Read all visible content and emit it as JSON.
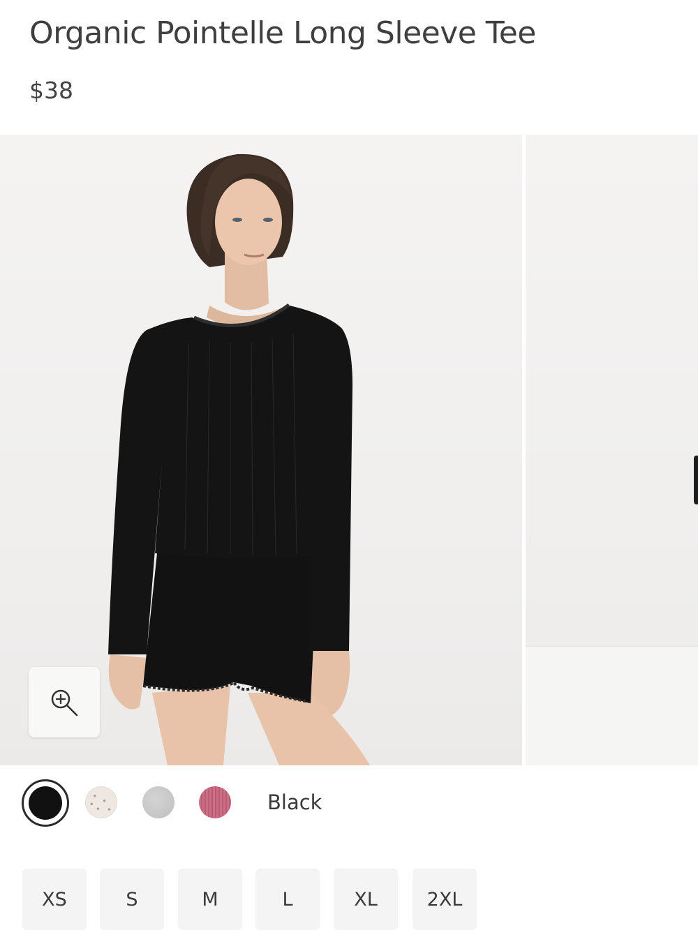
{
  "product": {
    "title": "Organic Pointelle Long Sleeve Tee",
    "price": "$38"
  },
  "gallery": {
    "images": [
      {
        "description_icon": "model-image",
        "active": true
      },
      {
        "description_icon": "model-image",
        "active": false
      }
    ],
    "zoom_icon": "zoom-in-icon"
  },
  "colors": {
    "selected_label": "Black",
    "swatches": [
      {
        "name": "swatch-black",
        "color": "#111111",
        "selected": true
      },
      {
        "name": "swatch-oat",
        "color": "#efe7e2",
        "selected": false
      },
      {
        "name": "swatch-grey",
        "color": "#c8c8c8",
        "selected": false
      },
      {
        "name": "swatch-rose",
        "color": "#c66880",
        "selected": false
      }
    ]
  },
  "sizes": [
    "XS",
    "S",
    "M",
    "L",
    "XL",
    "2XL"
  ]
}
